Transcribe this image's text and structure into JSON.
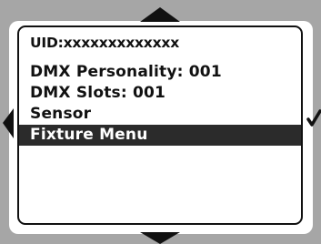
{
  "header": {
    "uid": "UID:xxxxxxxxxxxxx"
  },
  "menu": {
    "items": [
      {
        "label": "DMX Personality: 001",
        "selected": false
      },
      {
        "label": "DMX Slots: 001",
        "selected": false
      },
      {
        "label": "Sensor",
        "selected": false
      },
      {
        "label": "Fixture Menu",
        "selected": true
      }
    ]
  },
  "controls": {
    "up_icon": "up-triangle",
    "down_icon": "down-triangle",
    "left_icon": "left-triangle",
    "enter_icon": "checkmark"
  },
  "colors": {
    "frame": "#a6a6a6",
    "selection_bg": "#2b2b2b",
    "text": "#111111"
  }
}
